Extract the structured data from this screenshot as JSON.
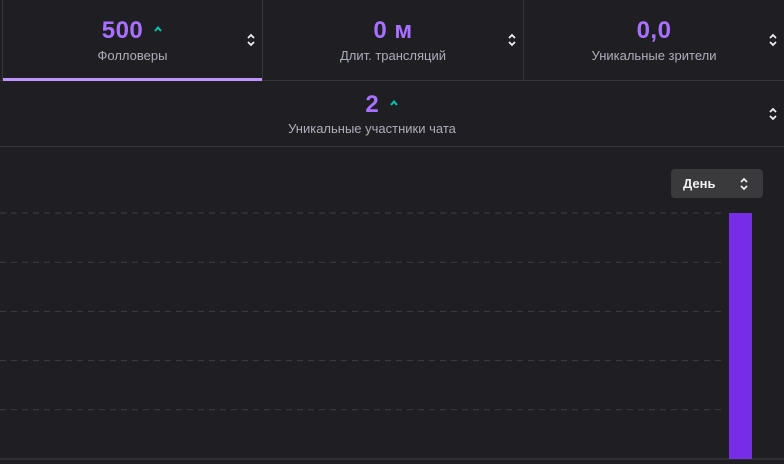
{
  "stats": [
    {
      "value": "500",
      "label": "Фолловеры",
      "trend": "up-caret",
      "active": true
    },
    {
      "value": "0 м",
      "label": "Длит. трансляций"
    },
    {
      "value": "0,0",
      "label": "Уникальные зрители"
    }
  ],
  "stat_chat": {
    "value": "2",
    "label": "Уникальные участники чата",
    "trend": "up-caret"
  },
  "period_select": {
    "selected": "День"
  },
  "icons": {
    "sort": "sort-arrows-icon",
    "trend": "up-caret-icon",
    "select": "select-arrows-icon"
  },
  "colors": {
    "accent": "#a970ff",
    "active_underline": "#bf94ff",
    "trend_up": "#00c8af",
    "bar": "#772ce8",
    "background": "#1f1f23",
    "grid": "#3d3d42"
  },
  "chart_data": {
    "type": "bar",
    "grid": "dashed horizontal",
    "series": [
      {
        "values": [
          1
        ]
      }
    ],
    "ylim": [
      0,
      1
    ]
  }
}
